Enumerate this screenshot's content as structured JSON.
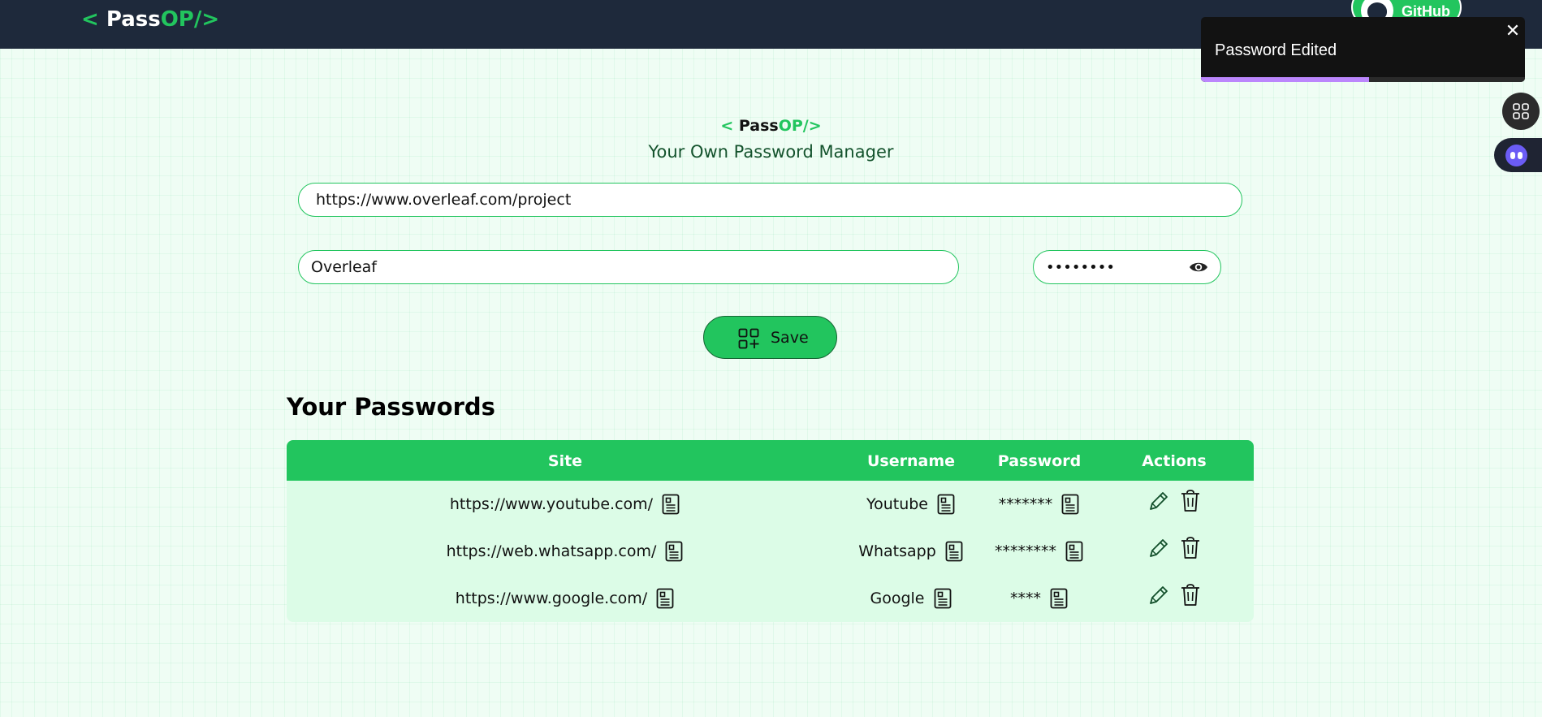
{
  "navbar": {
    "logo": {
      "open": "<",
      "pass": " Pass",
      "op": "OP/>"
    },
    "github_label": "GitHub"
  },
  "toast": {
    "message": "Password Edited",
    "close": "✕",
    "progress": 0.52,
    "progress_color": "#bb86fc"
  },
  "header": {
    "logo": {
      "open": "< ",
      "pass": "Pass",
      "op": "OP/>"
    },
    "tagline": "Your Own Password Manager"
  },
  "form": {
    "url_value": "https://www.overleaf.com/project",
    "username_value": "Overleaf",
    "password_value": "••••••••",
    "save_label": "Save"
  },
  "passwords": {
    "title": "Your Passwords",
    "headers": [
      "Site",
      "Username",
      "Password",
      "Actions"
    ],
    "rows": [
      {
        "site": "https://www.youtube.com/",
        "username": "Youtube",
        "password": "*******"
      },
      {
        "site": "https://web.whatsapp.com/",
        "username": "Whatsapp",
        "password": "********"
      },
      {
        "site": "https://www.google.com/",
        "username": "Google",
        "password": "****"
      }
    ]
  },
  "colors": {
    "accent": "#22c55e",
    "navbar": "#1e293b",
    "page_bg": "#effdf4",
    "row_bg": "#dcfce7"
  }
}
